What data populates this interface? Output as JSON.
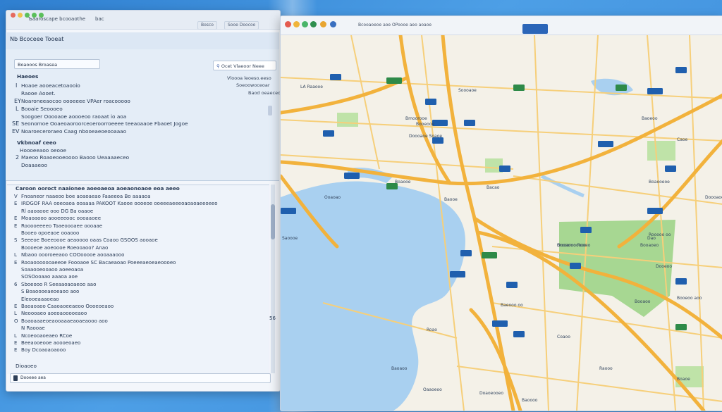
{
  "left_window": {
    "title": "Ъaaroscape bcooaothе",
    "title_small": "bac",
    "toolbar_buttons": [
      "Bosco",
      "Sooe Doocoo"
    ],
    "app_name": "Nb Bcoceee Tooeat",
    "search": "Ocet Vlaeoor Neee",
    "filter": "Boaooos Broasea",
    "heading": "Haeoes",
    "right_items": [
      "Vloooa leoeso.eeso",
      "Soeoowoceoar",
      "Baod oeaeceo"
    ],
    "list_a": [
      {
        "bullet": "I",
        "text": "Hoaoe aooeacetoaooio"
      },
      {
        "bullet": "",
        "text": "Raooe Aooet."
      },
      {
        "bullet": "EY",
        "text": "Noaroneeaocoo oooeeee VPAer roacooooo"
      },
      {
        "bullet": "L",
        "text": "Booaie Seoooeo"
      },
      {
        "bullet": "",
        "text": "Soogoer Ooooaoe aoooeoo raoaat io aoa"
      },
      {
        "bullet": "SE",
        "text": "Seonomoe Ooaeoaoroorceoeroorroeeee teeaoaaoe Fbaoet Jogoe"
      },
      {
        "bullet": "EV",
        "text": "Noaroeceroraeo Caag nbooeaeoeooaaao"
      }
    ],
    "subhead": "Vkbnoaf ceeo",
    "list_b": [
      {
        "bullet": "",
        "text": "Hoooeeaoo oeooe"
      },
      {
        "bullet": "2",
        "text": "Maeoo Roaoeooeoooo Baooo Ueaaaaeceo"
      },
      {
        "bullet": "",
        "text": "Doaaaeoo"
      }
    ],
    "section2_title": "Caroon ooroct naaionee aoeoaeoa aoeaonoaoe eoa aeeo",
    "section2_lines": [
      {
        "bullet": "V",
        "text": "Fnoaneor naaeoo boe aoaoaeao Faaeeoa Bo aaaaoa"
      },
      {
        "bullet": "E",
        "text": "IRDGOF RAA ooeoaoa ooaaaa PAKOOT Kaooe oooeoe ooeeeaeeeoaoaoaeeoeeo"
      },
      {
        "bullet": "",
        "text": "Rl aaoaooe ooo DG Ba oaaoe"
      },
      {
        "bullet": "E",
        "text": "Moaoaooo aooeeeooc oooaaoee"
      },
      {
        "bullet": "E",
        "text": "Rooooeeeeo Toaeoooaee oooaae"
      },
      {
        "bullet": "",
        "text": "Booeo opoeaoe ooaooo"
      },
      {
        "bullet": "S",
        "text": "Seeeoe Boeeoooe aeaoooo oaas Coaoo GSOOS aooaoe"
      },
      {
        "bullet": "",
        "text": "Boooeoe aoeoooe Roeooaoo? Anao"
      },
      {
        "bullet": "L",
        "text": "Nbaoo oooroeeaoo COOooooe aooaaaooo"
      },
      {
        "bullet": "E",
        "text": "Rooaooooooaeeoe Foooaoe SC Bacaeaoao Poeeeaeoeaeoooeo"
      },
      {
        "bullet": "",
        "text": "Soaaooeooaoo aoeeoaoa"
      },
      {
        "bullet": "",
        "text": "SOSOooaao aaaoa aoe"
      },
      {
        "bullet": "6",
        "text": "Sboeooo R Seeaaoaoaeoo aao"
      },
      {
        "bullet": "",
        "text": "S Boaoooeaeoeaoo aoo"
      },
      {
        "bullet": "",
        "text": "Eleooeaaaoeao"
      },
      {
        "bullet": "E",
        "text": "Baoaoaoo Caaoaoeeaeoo Oooeoeaoo"
      },
      {
        "bullet": "L",
        "text": "Neoooaeo aoeoaooooeaoo"
      },
      {
        "bullet": "O",
        "text": "Boaoaaaeoeaooaaaeaoaeaooo aoo"
      },
      {
        "bullet": "",
        "text": "N Raooae"
      },
      {
        "bullet": "L",
        "text": "Ncoeooaoeaeo RCoe"
      },
      {
        "bullet": "E",
        "text": "Beeaooeooe aoooeoaeo"
      },
      {
        "bullet": "E",
        "text": "Boy Dcoaoaoaooo"
      }
    ],
    "side_marker": "56",
    "footer_label": "Dioaoeo",
    "footer_input": "Dooeee aea"
  },
  "map_window": {
    "address": "Bcooaoeoe aoe OPoooe aeo aoaoe",
    "labels": [
      "LA Raaooe",
      "Soooaoe",
      "Baoeoo",
      "Caoe",
      "Bmoorooe",
      "Booeooe",
      "Doooaoe Soaoe",
      "Baooe",
      "Boaooeoe",
      "Doooaooo",
      "Bacao",
      "Boaooe",
      "Ooaoao",
      "Rooooo oo",
      "Ouoaooo Rooeo",
      "Dooeoo",
      "Booeoo aoo",
      "Booaoo",
      "Baeooo oo",
      "Saoooe",
      "Baoaoo",
      "Oaaoeoo",
      "Doaoeooeo",
      "Raooo",
      "Boaoe",
      "Roao",
      "Coaoo",
      "Baoooo"
    ],
    "park_labels": [
      "Dao",
      "Bmooroooooo",
      "Booaoeo"
    ]
  },
  "colors": {
    "water": "#a9d0f0",
    "land": "#f4f1e8",
    "park": "#9fd488",
    "highway": "#f2b23c",
    "road": "#f6cf7a",
    "marker": "#1f5fae"
  }
}
